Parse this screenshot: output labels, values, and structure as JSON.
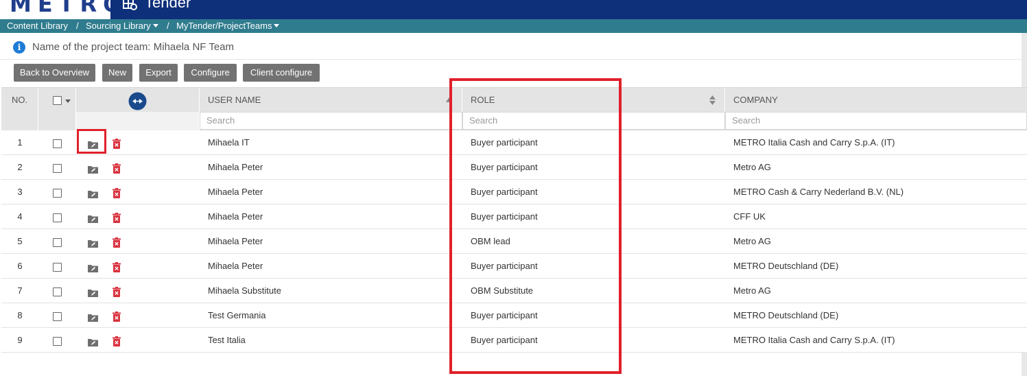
{
  "header": {
    "logo": "METRO",
    "app_title": "Tender"
  },
  "breadcrumb": {
    "items": [
      "Content Library",
      "Sourcing Library",
      "MyTender/ProjectTeams"
    ],
    "separator": "/"
  },
  "info": {
    "text": "Name of the project team: Mihaela NF Team"
  },
  "toolbar": {
    "back": "Back to Overview",
    "new": "New",
    "export": "Export",
    "configure": "Configure",
    "client_configure": "Client configure"
  },
  "table": {
    "columns": {
      "no": "NO.",
      "user_name": "USER NAME",
      "role": "ROLE",
      "company": "COMPANY"
    },
    "search_placeholder": "Search",
    "rows": [
      {
        "no": "1",
        "user": "Mihaela IT",
        "role": "Buyer participant",
        "company": "METRO Italia Cash and Carry S.p.A. (IT)"
      },
      {
        "no": "2",
        "user": "Mihaela Peter",
        "role": "Buyer participant",
        "company": "Metro AG"
      },
      {
        "no": "3",
        "user": "Mihaela Peter",
        "role": "Buyer participant",
        "company": "METRO Cash & Carry Nederland B.V. (NL)"
      },
      {
        "no": "4",
        "user": "Mihaela Peter",
        "role": "Buyer participant",
        "company": "CFF UK"
      },
      {
        "no": "5",
        "user": "Mihaela Peter",
        "role": "OBM lead",
        "company": "Metro AG"
      },
      {
        "no": "6",
        "user": "Mihaela Peter",
        "role": "Buyer participant",
        "company": "METRO Deutschland (DE)"
      },
      {
        "no": "7",
        "user": "Mihaela Substitute",
        "role": "OBM Substitute",
        "company": "Metro AG"
      },
      {
        "no": "8",
        "user": "Test Germania",
        "role": "Buyer participant",
        "company": "METRO Deutschland (DE)"
      },
      {
        "no": "9",
        "user": "Test Italia",
        "role": "Buyer participant",
        "company": "METRO Italia Cash and Carry S.p.A. (IT)"
      }
    ]
  },
  "colors": {
    "appbar": "#0e2f7a",
    "breadcrumb_bar": "#2f7c8e",
    "button": "#727272",
    "highlight": "#e0202a",
    "delete_icon": "#d9333f"
  }
}
